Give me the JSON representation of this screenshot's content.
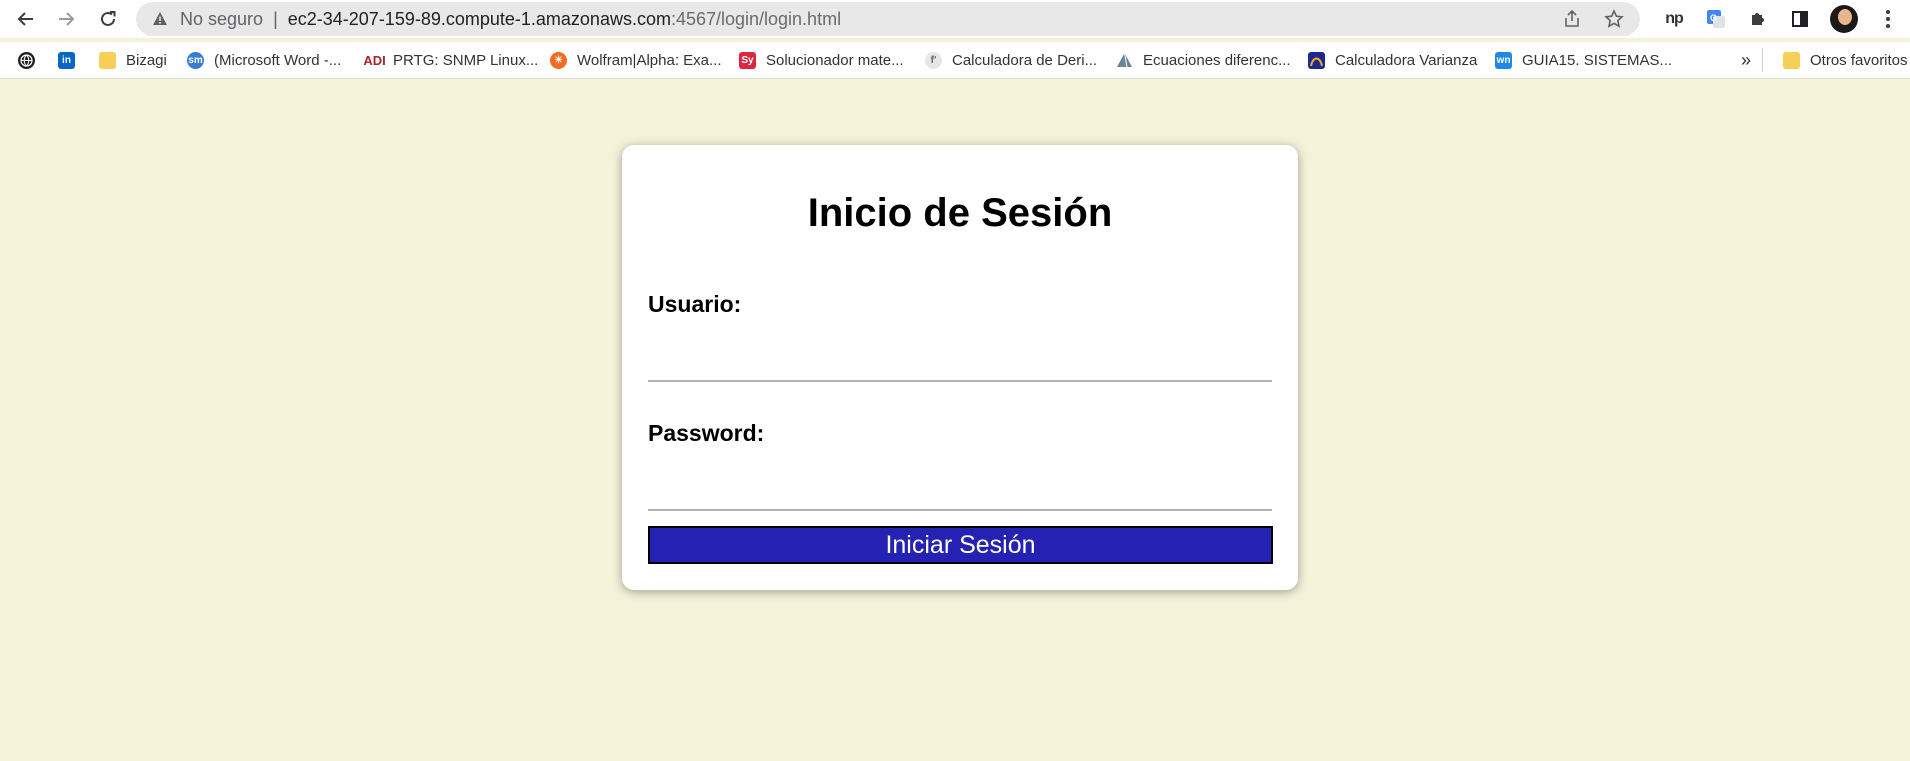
{
  "browser": {
    "address_bar": {
      "security_text": "No seguro",
      "separator": "|",
      "host": "ec2-34-207-159-89.compute-1.amazonaws.com",
      "path": ":4567/login/login.html"
    },
    "extensions": {
      "np_label": "np"
    },
    "bookmarks": [
      {
        "label": "",
        "icon": "globe-icon"
      },
      {
        "label": "",
        "icon": "linkedin-icon"
      },
      {
        "label": "Bizagi",
        "icon": "folder-icon"
      },
      {
        "label": "(Microsoft Word -...",
        "icon": "sm-icon"
      },
      {
        "label": "PRTG: SNMP Linux...",
        "icon": "prtg-icon"
      },
      {
        "label": "Wolfram|Alpha: Exa...",
        "icon": "wolfram-icon"
      },
      {
        "label": "Solucionador mate...",
        "icon": "symbolab-icon"
      },
      {
        "label": "Calculadora de Deri...",
        "icon": "derivative-icon"
      },
      {
        "label": "Ecuaciones diferenc...",
        "icon": "pyramid-icon"
      },
      {
        "label": "Calculadora Varianza",
        "icon": "varianza-icon"
      },
      {
        "label": "GUIA15. SISTEMAS...",
        "icon": "wn-icon"
      }
    ],
    "overflow_label": "»",
    "other_bookmarks_label": "Otros favoritos"
  },
  "login": {
    "title": "Inicio de Sesión",
    "username_label": "Usuario:",
    "username_value": "",
    "password_label": "Password:",
    "password_value": "",
    "submit_label": "Iniciar Sesión"
  },
  "colors": {
    "page_background": "#f4f3da",
    "button_background": "#2521b3",
    "button_text": "#ffffff"
  }
}
